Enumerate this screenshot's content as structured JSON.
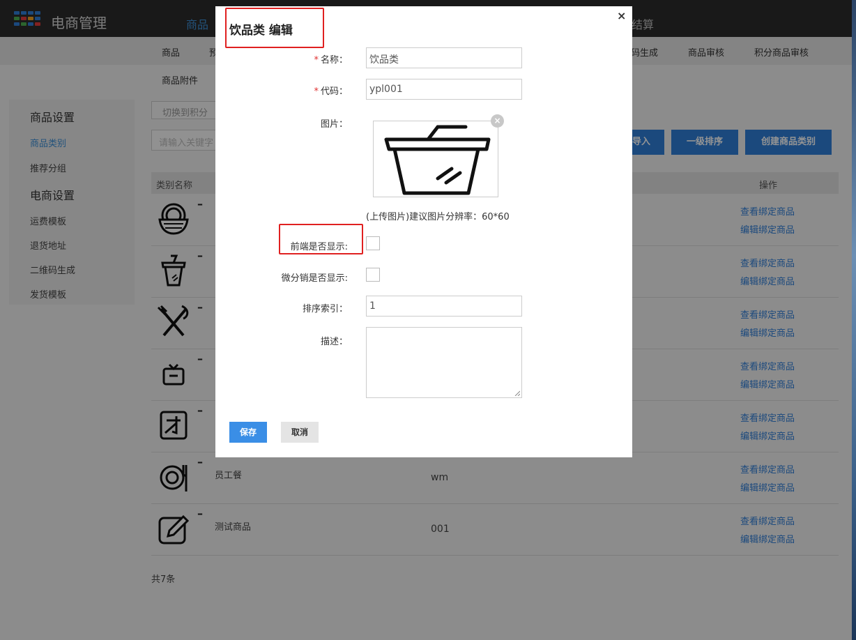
{
  "app": {
    "title": "电商管理"
  },
  "top_nav": {
    "active": "商品",
    "partial_right": "结算"
  },
  "sub_nav": [
    "商品",
    "预",
    "码生成",
    "商品审核",
    "积分商品审核",
    "商品附件"
  ],
  "sidebar": {
    "group1": "商品设置",
    "items1": [
      "商品类别",
      "推荐分组"
    ],
    "group2": "电商设置",
    "items2": [
      "运费模板",
      "退货地址",
      "二维码生成",
      "发货模板"
    ]
  },
  "toolbar": {
    "switch_label": "切换到积分",
    "search_placeholder": "请输入关键字",
    "import_label": "导入",
    "sort_label": "一级排序",
    "create_label": "创建商品类别"
  },
  "table": {
    "col_name": "类别名称",
    "col_ops": "操作",
    "rows": [
      {
        "icon": "noodle-bowl-icon",
        "name": "",
        "code": ""
      },
      {
        "icon": "drink-cup-icon",
        "name": "",
        "code": ""
      },
      {
        "icon": "fork-knife-icon",
        "name": "",
        "code": ""
      },
      {
        "icon": "gift-box-icon",
        "name": "",
        "code": ""
      },
      {
        "icon": "talent-box-icon",
        "name": "",
        "code": ""
      },
      {
        "icon": "plate-icon",
        "name": "员工餐",
        "code": "wm"
      },
      {
        "icon": "edit-pen-icon",
        "name": "测试商品",
        "code": "001"
      }
    ],
    "link_view": "查看绑定商品",
    "link_edit": "编辑绑定商品",
    "total": "共7条"
  },
  "modal": {
    "title": "饮品类 编辑",
    "close": "×",
    "name_label": "名称：",
    "name_value": "饮品类",
    "code_label": "代码：",
    "code_value": "ypl001",
    "image_label": "图片：",
    "image_remove": "×",
    "upload_hint": "(上传图片)建议图片分辨率：60*60",
    "frontend_label": "前端是否显示:",
    "frontend_checked": false,
    "micro_label": "微分销是否显示:",
    "micro_checked": false,
    "sort_label": "排序索引：",
    "sort_value": "1",
    "desc_label": "描述：",
    "desc_value": "",
    "save": "保存",
    "cancel": "取消"
  },
  "colors": {
    "accent": "#2f7ed8",
    "highlight": "#e02020"
  }
}
